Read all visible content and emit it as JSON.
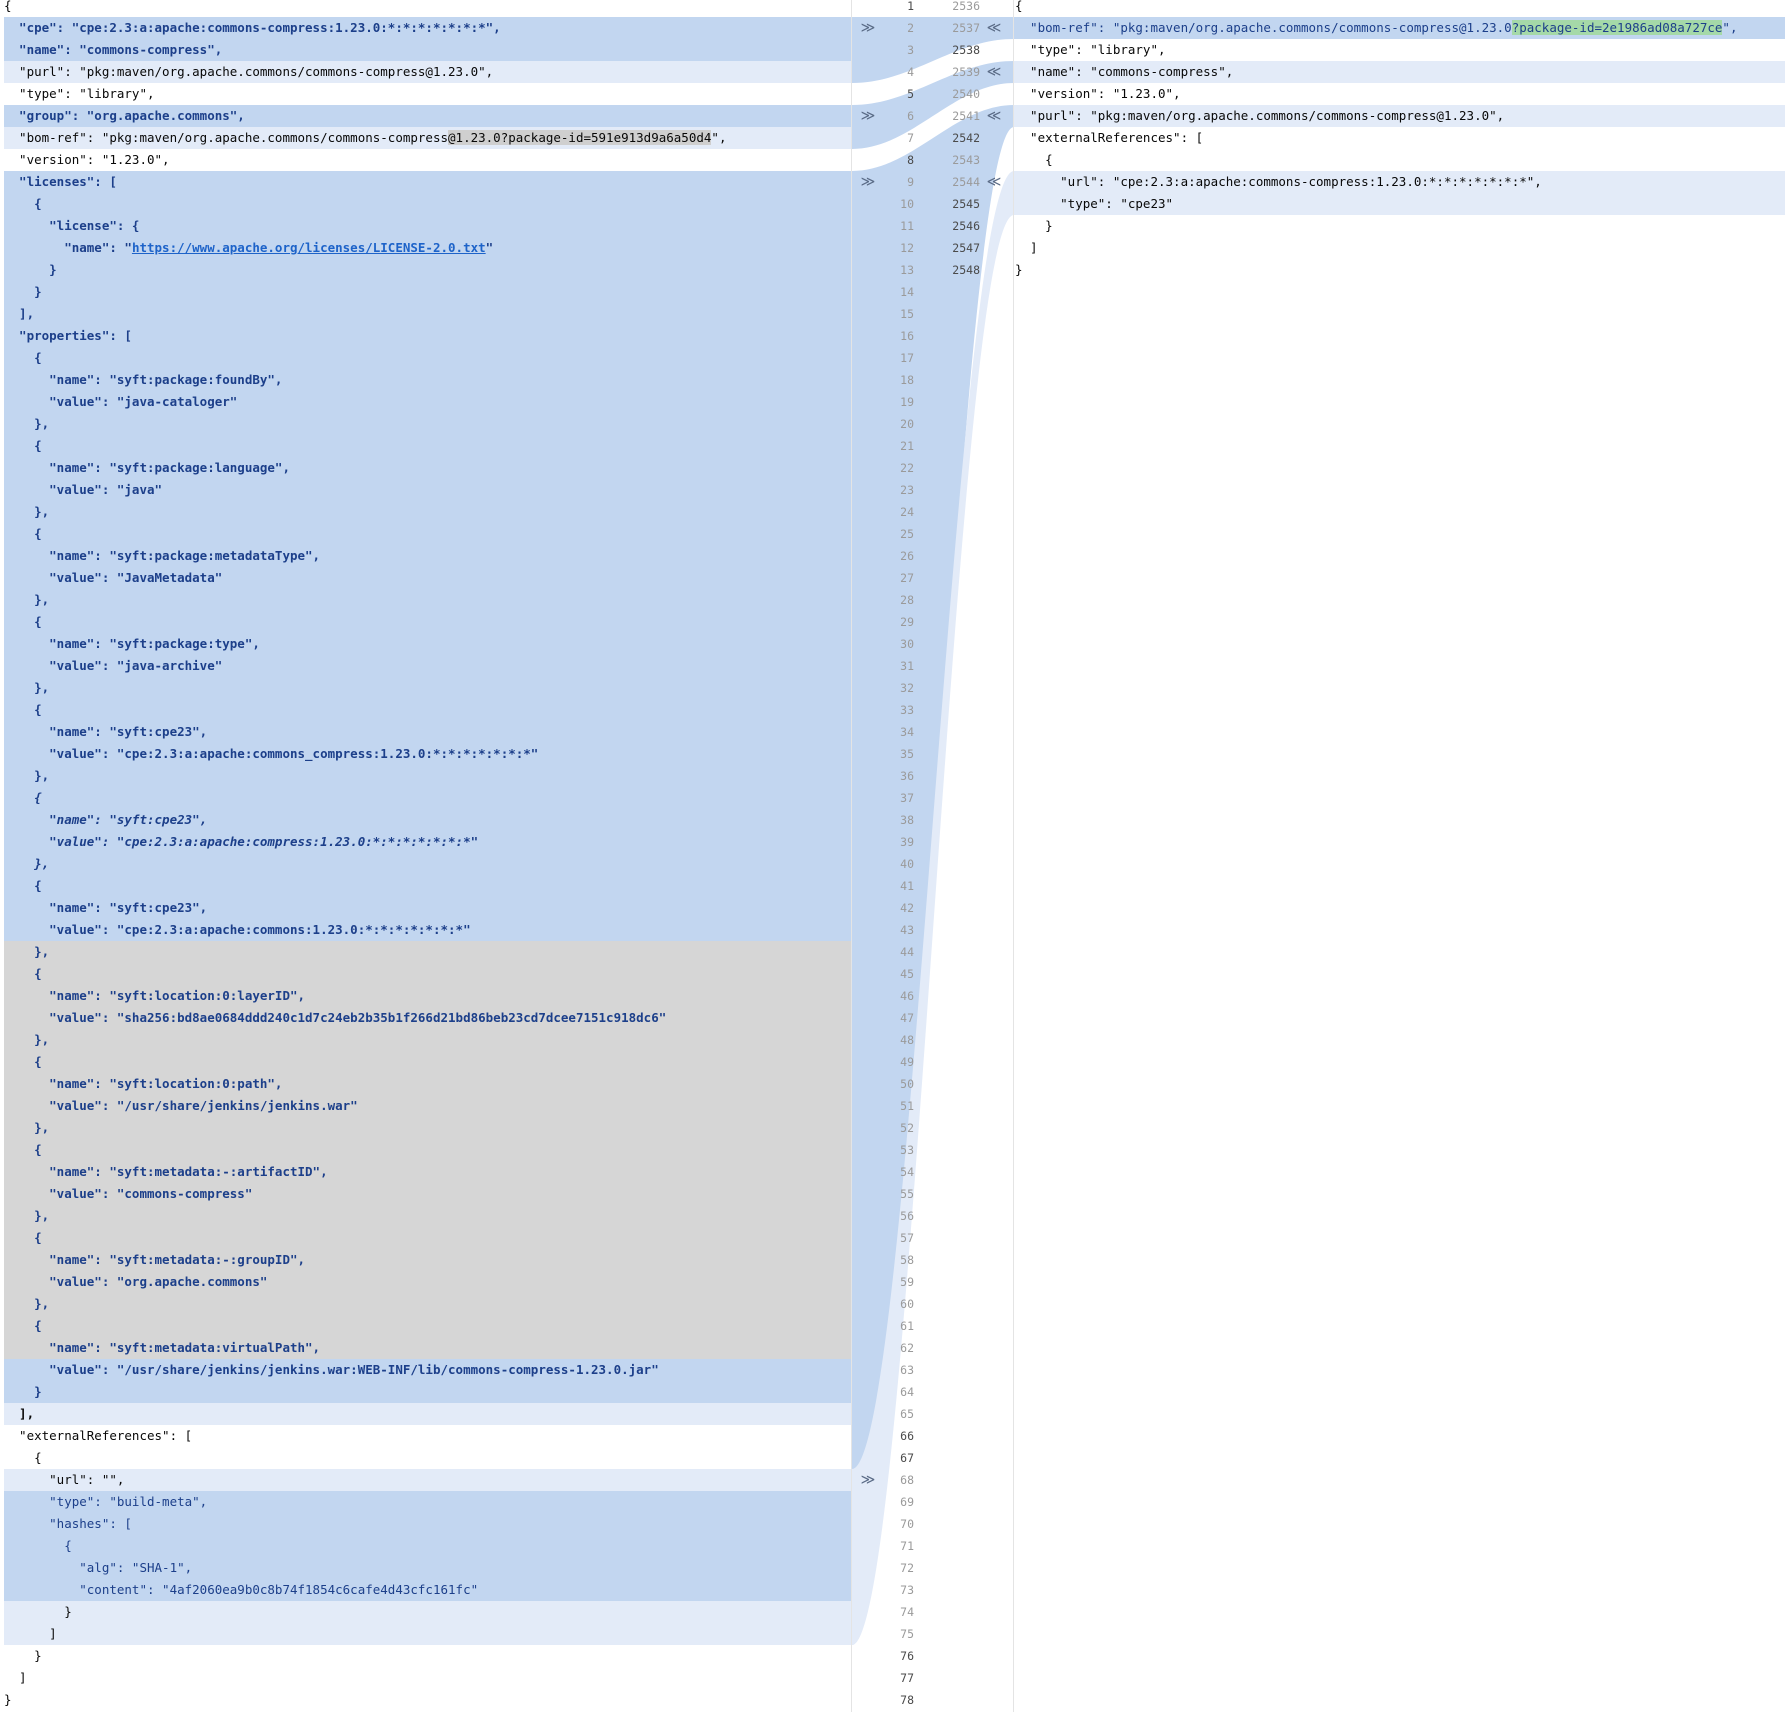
{
  "left": {
    "first_line": 1,
    "lines": [
      "{",
      "  \"cpe\": \"cpe:2.3:a:apache:commons-compress:1.23.0:*:*:*:*:*:*:*\",",
      "  \"name\": \"commons-compress\",",
      "  \"purl\": \"pkg:maven/org.apache.commons/commons-compress@1.23.0\",",
      "  \"type\": \"library\",",
      "  \"group\": \"org.apache.commons\",",
      "  \"bom-ref\": \"pkg:maven/org.apache.commons/commons-compress@1.23.0?package-id=591e913d9a6a50d4\",",
      "  \"version\": \"1.23.0\",",
      "  \"licenses\": [",
      "    {",
      "      \"license\": {",
      "        \"name\": \"https://www.apache.org/licenses/LICENSE-2.0.txt\"",
      "      }",
      "    }",
      "  ],",
      "  \"properties\": [",
      "    {",
      "      \"name\": \"syft:package:foundBy\",",
      "      \"value\": \"java-cataloger\"",
      "    },",
      "    {",
      "      \"name\": \"syft:package:language\",",
      "      \"value\": \"java\"",
      "    },",
      "    {",
      "      \"name\": \"syft:package:metadataType\",",
      "      \"value\": \"JavaMetadata\"",
      "    },",
      "    {",
      "      \"name\": \"syft:package:type\",",
      "      \"value\": \"java-archive\"",
      "    },",
      "    {",
      "      \"name\": \"syft:cpe23\",",
      "      \"value\": \"cpe:2.3:a:apache:commons_compress:1.23.0:*:*:*:*:*:*:*\"",
      "    },",
      "    {",
      "      \"name\": \"syft:cpe23\",",
      "      \"value\": \"cpe:2.3:a:apache:compress:1.23.0:*:*:*:*:*:*:*\"",
      "    },",
      "    {",
      "      \"name\": \"syft:cpe23\",",
      "      \"value\": \"cpe:2.3:a:apache:commons:1.23.0:*:*:*:*:*:*:*\"",
      "    },",
      "    {",
      "      \"name\": \"syft:location:0:layerID\",",
      "      \"value\": \"sha256:bd8ae0684ddd240c1d7c24eb2b35b1f266d21bd86beb23cd7dcee7151c918dc6\"",
      "    },",
      "    {",
      "      \"name\": \"syft:location:0:path\",",
      "      \"value\": \"/usr/share/jenkins/jenkins.war\"",
      "    },",
      "    {",
      "      \"name\": \"syft:metadata:-:artifactID\",",
      "      \"value\": \"commons-compress\"",
      "    },",
      "    {",
      "      \"name\": \"syft:metadata:-:groupID\",",
      "      \"value\": \"org.apache.commons\"",
      "    },",
      "    {",
      "      \"name\": \"syft:metadata:virtualPath\",",
      "      \"value\": \"/usr/share/jenkins/jenkins.war:WEB-INF/lib/commons-compress-1.23.0.jar\"",
      "    }",
      "  ],",
      "  \"externalReferences\": [",
      "    {",
      "      \"url\": \"\",",
      "      \"type\": \"build-meta\",",
      "      \"hashes\": [",
      "        {",
      "          \"alg\": \"SHA-1\",",
      "          \"content\": \"4af2060ea9b0c8b74f1854c6cafe4d43cfc161fc\"",
      "        }",
      "      ]",
      "    }",
      "  ]",
      "}"
    ]
  },
  "right": {
    "first_line": 2536,
    "lines": [
      "{",
      "  \"bom-ref\": \"pkg:maven/org.apache.commons/commons-compress@1.23.0?package-id=2e1986ad08a727ce\",",
      "  \"type\": \"library\",",
      "  \"name\": \"commons-compress\",",
      "  \"version\": \"1.23.0\",",
      "  \"purl\": \"pkg:maven/org.apache.commons/commons-compress@1.23.0\",",
      "  \"externalReferences\": [",
      "    {",
      "      \"url\": \"cpe:2.3:a:apache:commons-compress:1.23.0:*:*:*:*:*:*:*\",",
      "      \"type\": \"cpe23\"",
      "    }",
      "  ]",
      "}"
    ]
  },
  "gutter": {
    "left_arrow_glyph": "≫",
    "right_arrow_glyph": "≪"
  },
  "colors": {
    "changed": "#c2d6f0",
    "changed_light": "#e3ebf8",
    "deleted_block": "#d6d6d6",
    "inserted_word": "#a5d9a8",
    "keyword_text": "#1c3f8a"
  }
}
